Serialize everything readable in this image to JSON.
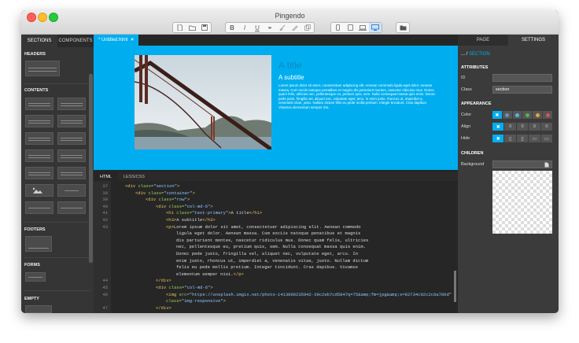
{
  "window": {
    "title": "Pingendo"
  },
  "toolbar": {
    "file_icons": [
      "new-file-icon",
      "open-folder-icon",
      "save-icon"
    ],
    "format_icons": [
      "bold-icon",
      "italic-icon",
      "underline-icon",
      "link-icon",
      "brush-icon",
      "pencil-icon",
      "copy-icon"
    ],
    "format_labels": {
      "bold": "B",
      "italic": "I",
      "underline": "U",
      "link": "⚭"
    },
    "device_icons": [
      "phone-icon",
      "tablet-icon",
      "laptop-icon",
      "desktop-icon"
    ],
    "folder_icon": "folder-icon"
  },
  "left_panel": {
    "tabs": [
      {
        "label": "SECTIONS",
        "active": true
      },
      {
        "label": "COMPONENTS",
        "active": false
      }
    ],
    "sections": [
      {
        "label": "HEADERS"
      },
      {
        "label": "CONTENTS"
      },
      {
        "label": "FOOTERS"
      },
      {
        "label": "FORMS"
      },
      {
        "label": "EMPTY"
      }
    ]
  },
  "editor": {
    "doc_tab": "* Untitled.html",
    "preview": {
      "title": "A title",
      "subtitle": "A subtitle",
      "paragraph": "Lorem ipsum dolor sit amet, consectetuer adipiscing elit. Aenean commodo ligula eget dolor. Aenean massa. Cum sociis natoque penatibus et magnis dis parturient montes, nascetur ridiculus mus. Donec quam felis, ultricies nec, pellentesque eu, pretium quis, sem. Nulla consequat massa quis enim. Donec pede justo, fringilla vel, aliquet nec, vulputate eget, arcu. In enim justo, rhoncus ut, imperdiet a, venenatis vitae, justo. Nullam dictum felis eu pede mollis pretium. Integer tincidunt. Cras dapibus. Vivamus elementum semper nisi."
    },
    "code_tabs": [
      {
        "label": "HTML",
        "active": true
      },
      {
        "label": "LESS/CSS",
        "active": false
      }
    ],
    "line_numbers": [
      37,
      38,
      39,
      40,
      41,
      42,
      43,
      "",
      "",
      "",
      "",
      "",
      "",
      "",
      44,
      45,
      46,
      "",
      47
    ],
    "code_lines": [
      {
        "indent": 0,
        "parts": [
          [
            "t",
            "<div "
          ],
          [
            "a",
            "class="
          ],
          [
            "s",
            "\"section\""
          ],
          [
            "t",
            ">"
          ]
        ]
      },
      {
        "indent": 1,
        "parts": [
          [
            "t",
            "<div "
          ],
          [
            "a",
            "class="
          ],
          [
            "s",
            "\"container\""
          ],
          [
            "t",
            ">"
          ]
        ]
      },
      {
        "indent": 2,
        "parts": [
          [
            "t",
            "<div "
          ],
          [
            "a",
            "class="
          ],
          [
            "s",
            "\"row\""
          ],
          [
            "t",
            ">"
          ]
        ]
      },
      {
        "indent": 3,
        "parts": [
          [
            "t",
            "<div "
          ],
          [
            "a",
            "class="
          ],
          [
            "s",
            "\"col-md-6\""
          ],
          [
            "t",
            ">"
          ]
        ]
      },
      {
        "indent": 4,
        "parts": [
          [
            "t",
            "<h1 "
          ],
          [
            "a",
            "class="
          ],
          [
            "s",
            "\"text-primary\""
          ],
          [
            "t",
            ">"
          ],
          [
            "x",
            "A title"
          ],
          [
            "t",
            "</h1>"
          ]
        ]
      },
      {
        "indent": 4,
        "parts": [
          [
            "t",
            "<h3>"
          ],
          [
            "x",
            "A subtitle"
          ],
          [
            "t",
            "</h3>"
          ]
        ]
      },
      {
        "indent": 4,
        "parts": [
          [
            "t",
            "<p>"
          ],
          [
            "x",
            "Lorem ipsum dolor sit amet, consectetuer adipiscing elit. Aenean commodo"
          ]
        ]
      },
      {
        "indent": 5,
        "parts": [
          [
            "x",
            "ligula eget dolor. Aenean massa. Cum sociis natoque penatibus et magnis"
          ]
        ]
      },
      {
        "indent": 5,
        "parts": [
          [
            "x",
            "dis parturient montes, nascetur ridiculus mus. Donec quam felis, ultricies"
          ]
        ]
      },
      {
        "indent": 5,
        "parts": [
          [
            "x",
            "nec, pellentesque eu, pretium quis, sem. Nulla consequat massa quis enim."
          ]
        ]
      },
      {
        "indent": 5,
        "parts": [
          [
            "x",
            "Donec pede justo, fringilla vel, aliquet nec, vulputate eget, arcu. In"
          ]
        ]
      },
      {
        "indent": 5,
        "parts": [
          [
            "x",
            "enim justo, rhoncus ut, imperdiet a, venenatis vitae, justo. Nullam dictum"
          ]
        ]
      },
      {
        "indent": 5,
        "parts": [
          [
            "x",
            "felis eu pede mollis pretium. Integer tincidunt. Cras dapibus. Vivamus"
          ]
        ]
      },
      {
        "indent": 5,
        "parts": [
          [
            "x",
            "elementum semper nisi."
          ],
          [
            "t",
            "</p>"
          ]
        ]
      },
      {
        "indent": 3,
        "parts": [
          [
            "t",
            "</div>"
          ]
        ]
      },
      {
        "indent": 3,
        "parts": [
          [
            "t",
            "<div "
          ],
          [
            "a",
            "class="
          ],
          [
            "s",
            "\"col-md-6\""
          ],
          [
            "t",
            ">"
          ]
        ]
      },
      {
        "indent": 4,
        "parts": [
          [
            "t",
            "<img "
          ],
          [
            "a",
            "src="
          ],
          [
            "s",
            "\"https://unsplash.imgix.net/photo-1413896235942-39c2eb7cd5847q=75&amp;fm=jpg&amp;s=82734c02c2c6a780d\""
          ]
        ]
      },
      {
        "indent": 4,
        "parts": [
          [
            "a",
            "class="
          ],
          [
            "s",
            "\"img-responsive\""
          ],
          [
            "t",
            ">"
          ]
        ]
      },
      {
        "indent": 3,
        "parts": [
          [
            "t",
            "</div>"
          ]
        ]
      }
    ]
  },
  "right_panel": {
    "tabs": [
      {
        "label": "PAGE",
        "active": false
      },
      {
        "label": "SETTINGS",
        "active": true
      }
    ],
    "breadcrumb": {
      "prefix": "... /",
      "current": "SECTION"
    },
    "attributes_heading": "ATTRIBUTES",
    "id_label": "ID",
    "id_value": "",
    "class_label": "Class",
    "class_value": "section",
    "appearance_heading": "APPEARANCE",
    "color_label": "Color",
    "colors": [
      "#00aeef",
      "#6b8ec4",
      "#4fb4e6",
      "#55b058",
      "#e6a23c",
      "#d9534f"
    ],
    "align_label": "Align",
    "hide_label": "Hide",
    "children_heading": "CHILDREN",
    "background_label": "Background",
    "accent": "#00aeef"
  }
}
